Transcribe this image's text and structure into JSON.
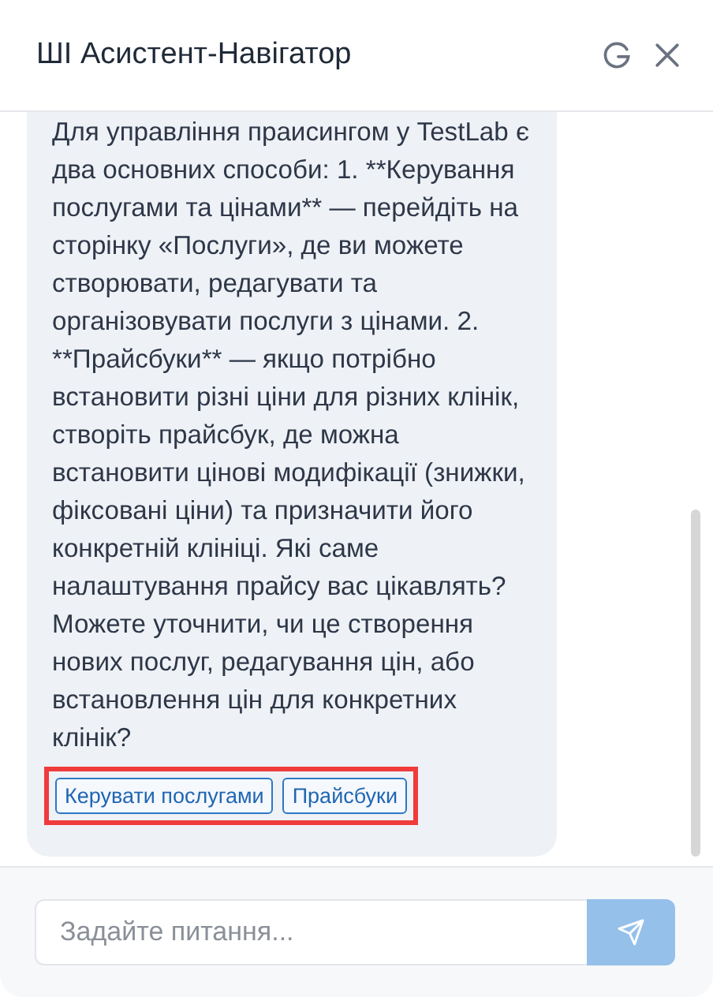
{
  "window": {
    "title": "ШІ Асистент-Навігатор"
  },
  "messages": [
    {
      "text": "Для управління праисингом у TestLab є два основних способи: 1. **Керування послугами та цінами** — перейдіть на сторінку «Послуги», де ви можете створювати, редагувати та організовувати послуги з цінами. 2. **Прайсбуки** — якщо потрібно встановити різні ціни для різних клінік, створіть прайсбук, де можна встановити цінові модифікації (знижки, фіксовані ціни) та призначити його конкретній клініці. Які саме налаштування прайсу вас цікавлять? Можете уточнити, чи це створення нових послуг, редагування цін, або встановлення цін для конкретних клінік?",
      "actions_highlighted": true,
      "actions": [
        "Керувати послугами",
        "Прайсбуки"
      ]
    }
  ],
  "input": {
    "placeholder": "Задайте питання..."
  }
}
